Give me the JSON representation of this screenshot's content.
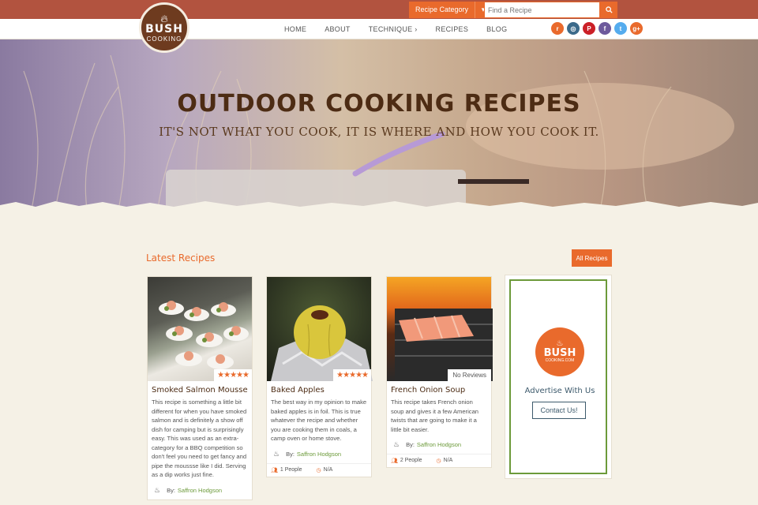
{
  "logo": {
    "line1": "BUSH",
    "line2": "COOKING",
    "icon": "flame-icon"
  },
  "header": {
    "category_label": "Recipe Category",
    "search_placeholder": "Find a Recipe",
    "search_icon": "search-icon"
  },
  "nav": {
    "items": [
      {
        "label": "HOME"
      },
      {
        "label": "ABOUT"
      },
      {
        "label": "TECHNIQUE ›"
      },
      {
        "label": "RECIPES"
      },
      {
        "label": "BLOG"
      }
    ]
  },
  "social": [
    {
      "name": "rss-icon",
      "glyph": "r",
      "color": "#e96a2c"
    },
    {
      "name": "instagram-icon",
      "glyph": "◎",
      "color": "#3b6a8a"
    },
    {
      "name": "pinterest-icon",
      "glyph": "P",
      "color": "#cb2027"
    },
    {
      "name": "facebook-icon",
      "glyph": "f",
      "color": "#6d5a9c"
    },
    {
      "name": "twitter-icon",
      "glyph": "t",
      "color": "#55acee"
    },
    {
      "name": "googleplus-icon",
      "glyph": "g+",
      "color": "#e96a2c"
    }
  ],
  "hero": {
    "title": "OUTDOOR COOKING RECIPES",
    "subtitle": "IT'S NOT WHAT YOU COOK, IT IS WHERE AND HOW YOU COOK IT."
  },
  "section": {
    "title": "Latest Recipes",
    "all_button": "All Recipes"
  },
  "cards": [
    {
      "title": "Smoked Salmon Mousse",
      "rating": "★★★★★",
      "description": "This recipe is something a little bit different for when you have smoked salmon and is definitely a show off dish for camping but is surprisingly easy. This was used as an extra-category for a BBQ competition so don't feel you need to get fancy and pipe the moussse like I did. Serving as a dip works just fine.",
      "by": "By:",
      "author": "Saffron Hodgson",
      "people": "",
      "time": ""
    },
    {
      "title": "Baked Apples",
      "rating": "★★★★★",
      "description": "The best way in my opinion to make baked apples is in foil. This is true whatever the recipe and whether you are cooking them in coals, a camp oven or home stove.",
      "by": "By:",
      "author": "Saffron Hodgson",
      "people": "1 People",
      "time": "N/A"
    },
    {
      "title": "French Onion Soup",
      "rating": "No Reviews",
      "description": "This recipe takes French onion soup and gives it a few American twists that are going to make it a little bit easier.",
      "by": "By:",
      "author": "Saffron Hodgson",
      "people": "2 People",
      "time": "N/A"
    }
  ],
  "ad": {
    "logo_line1": "BUSH",
    "logo_line2": "COOKING.COM",
    "title": "Advertise With Us",
    "button": "Contact Us!"
  },
  "colors": {
    "accent": "#e96a2c",
    "topbar": "#b2533f",
    "green": "#6c9a3a",
    "brown": "#4d2c14"
  }
}
